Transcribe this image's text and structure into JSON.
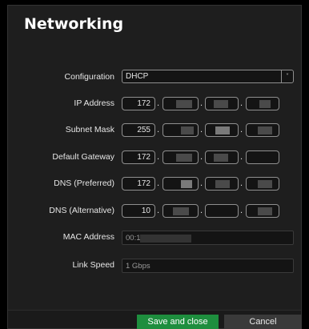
{
  "dialog": {
    "title": "Networking"
  },
  "fields": {
    "configuration": {
      "label": "Configuration",
      "value": "DHCP"
    },
    "ip_address": {
      "label": "IP Address",
      "octets": [
        "172",
        "",
        "",
        ""
      ]
    },
    "subnet_mask": {
      "label": "Subnet Mask",
      "octets": [
        "255",
        "",
        "",
        ""
      ]
    },
    "default_gateway": {
      "label": "Default Gateway",
      "octets": [
        "172",
        "",
        "",
        ""
      ]
    },
    "dns_preferred": {
      "label": "DNS (Preferred)",
      "octets": [
        "172",
        "",
        "",
        ""
      ]
    },
    "dns_alternative": {
      "label": "DNS (Alternative)",
      "octets": [
        "10",
        "",
        "",
        ""
      ]
    },
    "mac_address": {
      "label": "MAC Address",
      "value": "00:1"
    },
    "link_speed": {
      "label": "Link Speed",
      "value": "1 Gbps"
    }
  },
  "footer": {
    "save_label": "Save and close",
    "cancel_label": "Cancel"
  },
  "colors": {
    "primary_button": "#1e8e3e",
    "background": "#1e1e1e"
  }
}
